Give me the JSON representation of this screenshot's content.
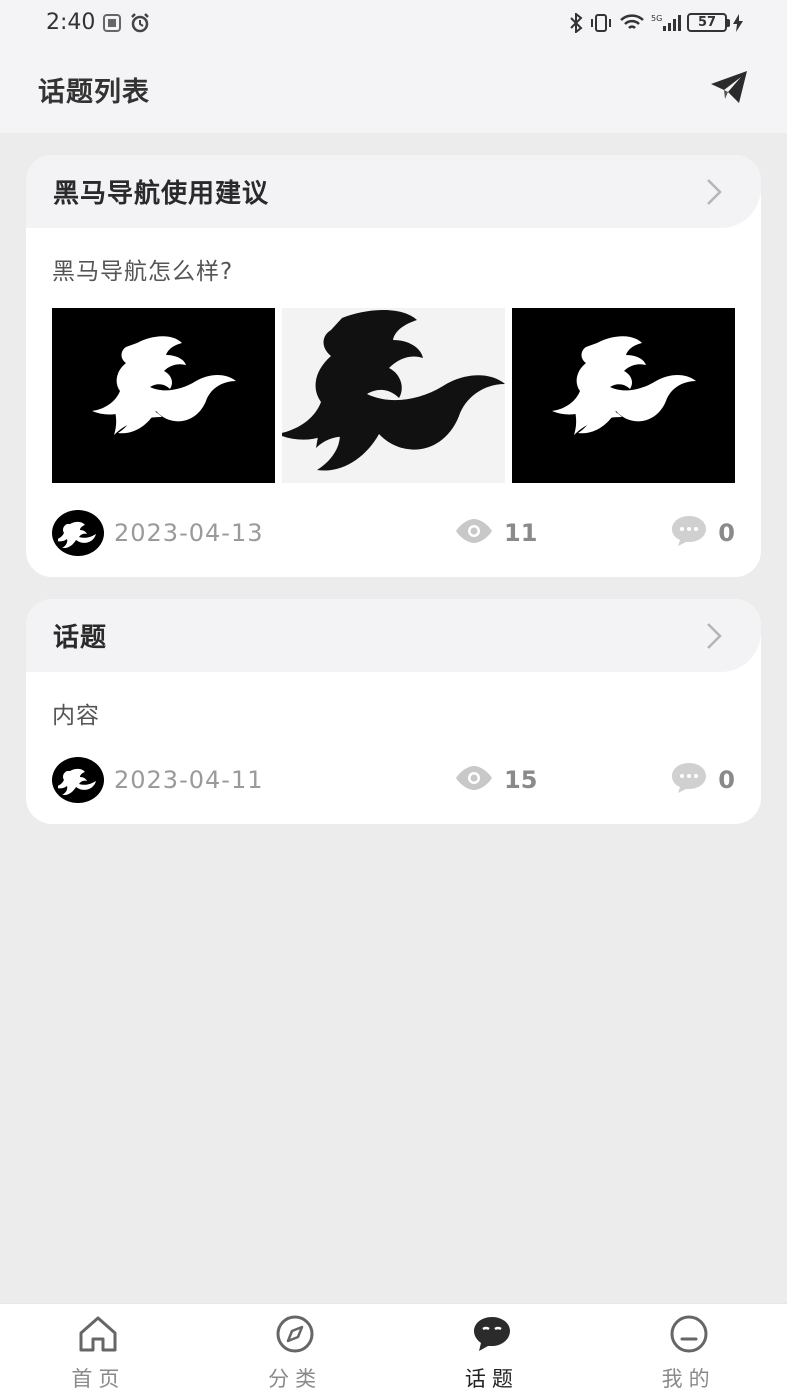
{
  "status_bar": {
    "time": "2:40",
    "battery": "57",
    "network": "5G"
  },
  "header": {
    "title": "话题列表",
    "send_icon": "send-icon"
  },
  "topics": [
    {
      "title": "黑马导航使用建议",
      "content": "黑马导航怎么样?",
      "date": "2023-04-13",
      "views": "11",
      "comments": "0",
      "image_count": 3
    },
    {
      "title": "话题",
      "content": "内容",
      "date": "2023-04-11",
      "views": "15",
      "comments": "0",
      "image_count": 0
    }
  ],
  "tabbar": {
    "items": [
      {
        "label": "首页",
        "icon": "home-icon"
      },
      {
        "label": "分类",
        "icon": "compass-icon"
      },
      {
        "label": "话题",
        "icon": "chat-icon",
        "active": true
      },
      {
        "label": "我的",
        "icon": "profile-icon"
      }
    ]
  },
  "colors": {
    "accent": "#222222",
    "muted": "#8a8a8a",
    "card": "#ffffff",
    "background": "#ececec"
  }
}
